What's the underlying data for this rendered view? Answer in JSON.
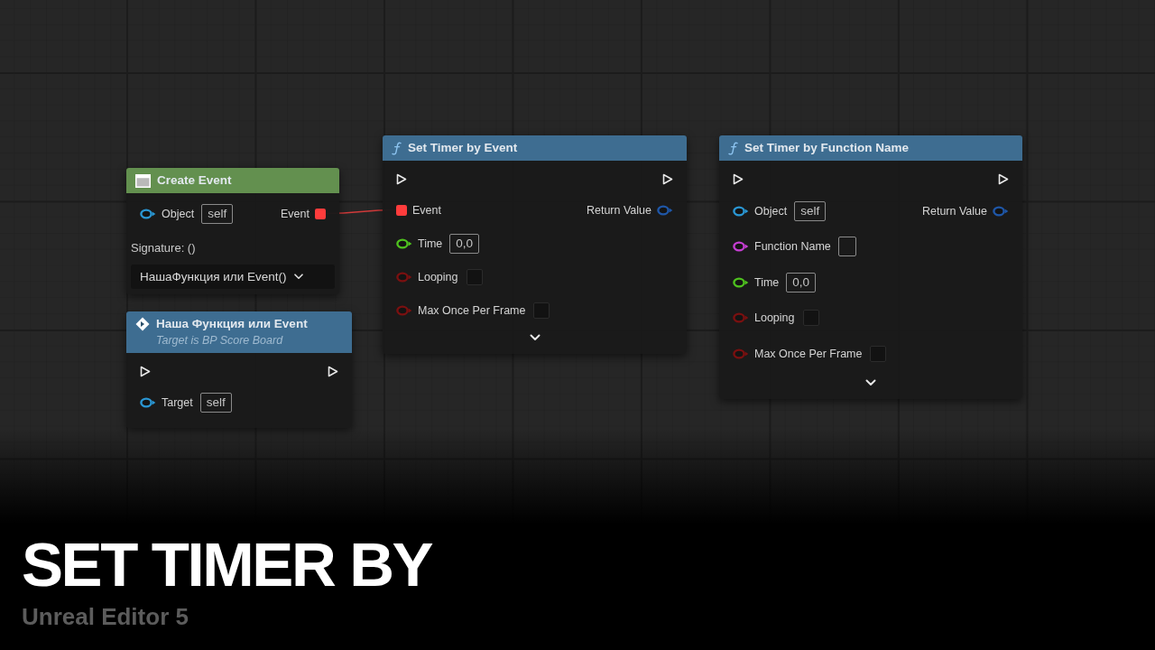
{
  "graph": {
    "nodes": [
      {
        "kind": "create_event",
        "title": "Create Event",
        "color": "#63904f",
        "rows": [
          {
            "left": {
              "kind": "object",
              "label": "Object",
              "value": "self",
              "linked": false
            },
            "right": {
              "kind": "delegate",
              "label": "Event",
              "linked": true
            }
          }
        ],
        "signature": "Signature: ()",
        "dropdown": "НашаФункция или Event()"
      },
      {
        "kind": "call",
        "title": "Наша Функция или Event",
        "subtitle": "Target is BP Score Board",
        "color": "#3e6d91",
        "rows": [
          {
            "left": {
              "kind": "exec",
              "linked": false
            },
            "right": {
              "kind": "exec",
              "linked": false
            }
          },
          {
            "left": {
              "kind": "object",
              "label": "Target",
              "value": "self",
              "linked": false
            }
          }
        ]
      },
      {
        "kind": "function",
        "title": "Set Timer by Event",
        "color": "#3e6d91",
        "rows": [
          {
            "left": {
              "kind": "exec",
              "linked": false
            },
            "right": {
              "kind": "exec",
              "linked": false
            }
          },
          {
            "left": {
              "kind": "delegate",
              "label": "Event",
              "linked": true
            },
            "right": {
              "kind": "struct",
              "label": "Return Value",
              "linked": false
            }
          },
          {
            "left": {
              "kind": "float",
              "label": "Time",
              "value": "0,0",
              "linked": false
            }
          },
          {
            "left": {
              "kind": "bool",
              "label": "Looping",
              "checked": false,
              "linked": false
            }
          },
          {
            "left": {
              "kind": "bool",
              "label": "Max Once Per Frame",
              "checked": false,
              "linked": false
            }
          }
        ],
        "advanced_expanded": false
      },
      {
        "kind": "function",
        "title": "Set Timer by Function Name",
        "color": "#3e6d91",
        "rows": [
          {
            "left": {
              "kind": "exec",
              "linked": false
            },
            "right": {
              "kind": "exec",
              "linked": false
            }
          },
          {
            "left": {
              "kind": "object",
              "label": "Object",
              "value": "self",
              "linked": false
            },
            "right": {
              "kind": "struct",
              "label": "Return Value",
              "linked": false
            }
          },
          {
            "left": {
              "kind": "name",
              "label": "Function Name",
              "linked": false
            }
          },
          {
            "left": {
              "kind": "float",
              "label": "Time",
              "value": "0,0",
              "linked": false
            }
          },
          {
            "left": {
              "kind": "bool",
              "label": "Looping",
              "checked": false,
              "linked": false
            }
          },
          {
            "left": {
              "kind": "bool",
              "label": "Max Once Per Frame",
              "checked": false,
              "linked": false
            }
          }
        ],
        "advanced_expanded": false
      }
    ]
  },
  "caption": {
    "title": "SET TIMER BY",
    "subtitle": "Unreal Editor 5"
  }
}
